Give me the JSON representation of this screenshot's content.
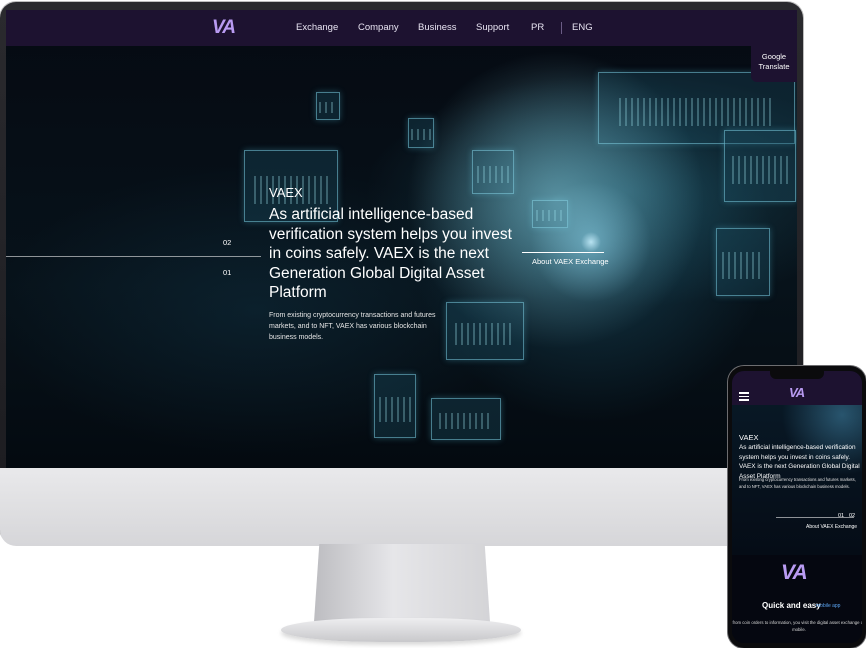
{
  "desktop": {
    "nav": {
      "logo": "VA",
      "links": [
        "Exchange",
        "Company",
        "Business",
        "Support",
        "PR",
        "ENG"
      ]
    },
    "google_translate": {
      "line1": "Google",
      "line2": "Translate"
    },
    "hero": {
      "eyebrow": "VAEX",
      "headline": "As artificial intelligence-based verification system helps you invest in coins safely. VAEX is the next Generation Global Digital Asset Platform",
      "subtext": "From existing cryptocurrency transactions and futures markets, and to NFT, VAEX has various blockchain business models.",
      "slide_numbers": [
        "02",
        "01"
      ],
      "about_link": "About VAEX Exchange"
    }
  },
  "mobile": {
    "logo": "VA",
    "hero": {
      "eyebrow": "VAEX",
      "headline": "As artificial intelligence-based verification system helps you invest in coins safely. VAEX is the next Generation Global Digital Asset Platform",
      "subtext": "From existing cryptocurrency transactions and futures markets, and to NFT, VAEX has various blockchain business models.",
      "slide_numbers": [
        "01",
        "02"
      ],
      "about_link": "About VAEX Exchange"
    },
    "app_section": {
      "logo": "VA",
      "title": "Quick and easy",
      "tag": "mobile app",
      "description": "from coin orders to information, you visit the digital asset exchange on mobile."
    }
  },
  "colors": {
    "nav_bg": "#1d1230",
    "logo": "#b99bf2",
    "accent_blue": "#5aa3f0"
  }
}
